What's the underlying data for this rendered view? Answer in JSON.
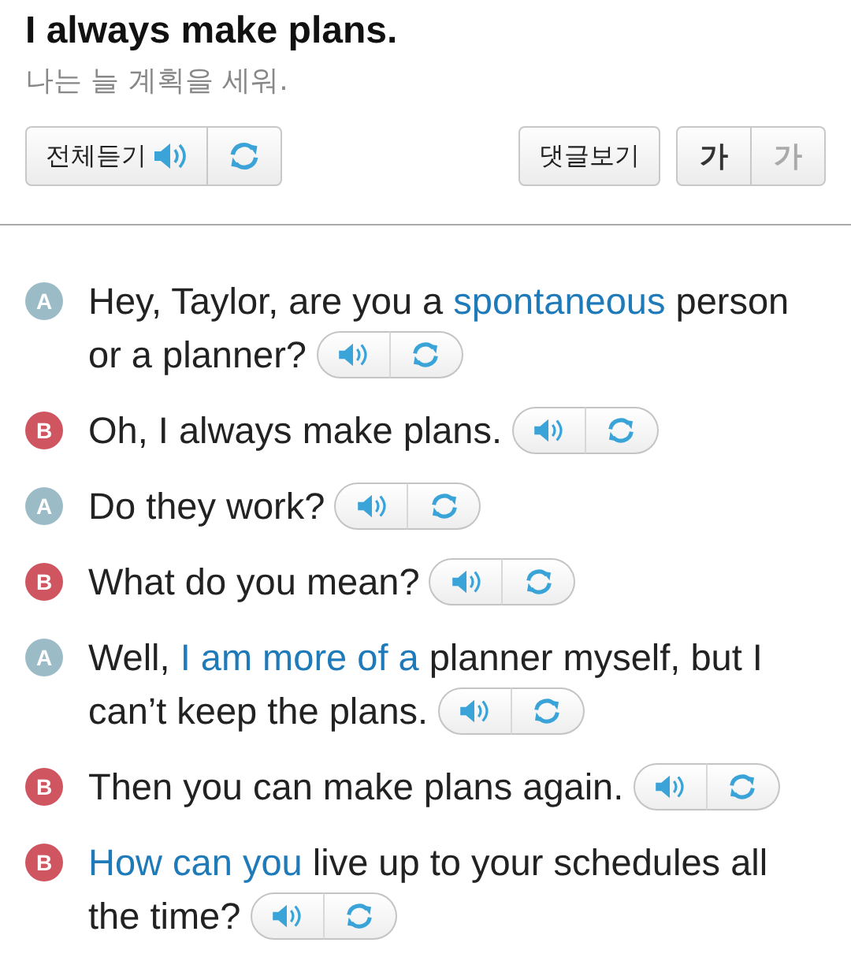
{
  "title": "I always make plans.",
  "translation": "나는 늘 계획을 세워.",
  "toolbar": {
    "listen_all": "전체듣기",
    "comments": "댓글보기",
    "font_sizes": [
      {
        "label": "가",
        "selected": true
      },
      {
        "label": "가",
        "selected": false
      }
    ]
  },
  "dialogue": [
    {
      "speaker": "A",
      "color": "#9bbcc6",
      "lines": [
        [
          {
            "text": "Hey, Taylor, are you a ",
            "highlight": false
          },
          {
            "text": "spontaneous",
            "highlight": true
          },
          {
            "text": " person",
            "highlight": false
          }
        ],
        [
          {
            "text": "or a planner?",
            "highlight": false
          }
        ]
      ]
    },
    {
      "speaker": "B",
      "color": "#cf5561",
      "lines": [
        [
          {
            "text": "Oh, I always make plans.",
            "highlight": false
          }
        ]
      ]
    },
    {
      "speaker": "A",
      "color": "#9bbcc6",
      "lines": [
        [
          {
            "text": "Do they work?",
            "highlight": false
          }
        ]
      ]
    },
    {
      "speaker": "B",
      "color": "#cf5561",
      "lines": [
        [
          {
            "text": "What do you mean?",
            "highlight": false
          }
        ]
      ]
    },
    {
      "speaker": "A",
      "color": "#9bbcc6",
      "lines": [
        [
          {
            "text": "Well, ",
            "highlight": false
          },
          {
            "text": "I am more of a",
            "highlight": true
          },
          {
            "text": " planner myself, but I",
            "highlight": false
          }
        ],
        [
          {
            "text": "can’t keep the plans.",
            "highlight": false
          }
        ]
      ]
    },
    {
      "speaker": "B",
      "color": "#cf5561",
      "lines": [
        [
          {
            "text": "Then you can make plans again.",
            "highlight": false
          }
        ]
      ]
    },
    {
      "speaker": "B",
      "color": "#cf5561",
      "lines": [
        [
          {
            "text": "How can you",
            "highlight": true
          },
          {
            "text": " live up to your schedules all",
            "highlight": false
          }
        ],
        [
          {
            "text": "the time?",
            "highlight": false
          }
        ]
      ]
    }
  ]
}
